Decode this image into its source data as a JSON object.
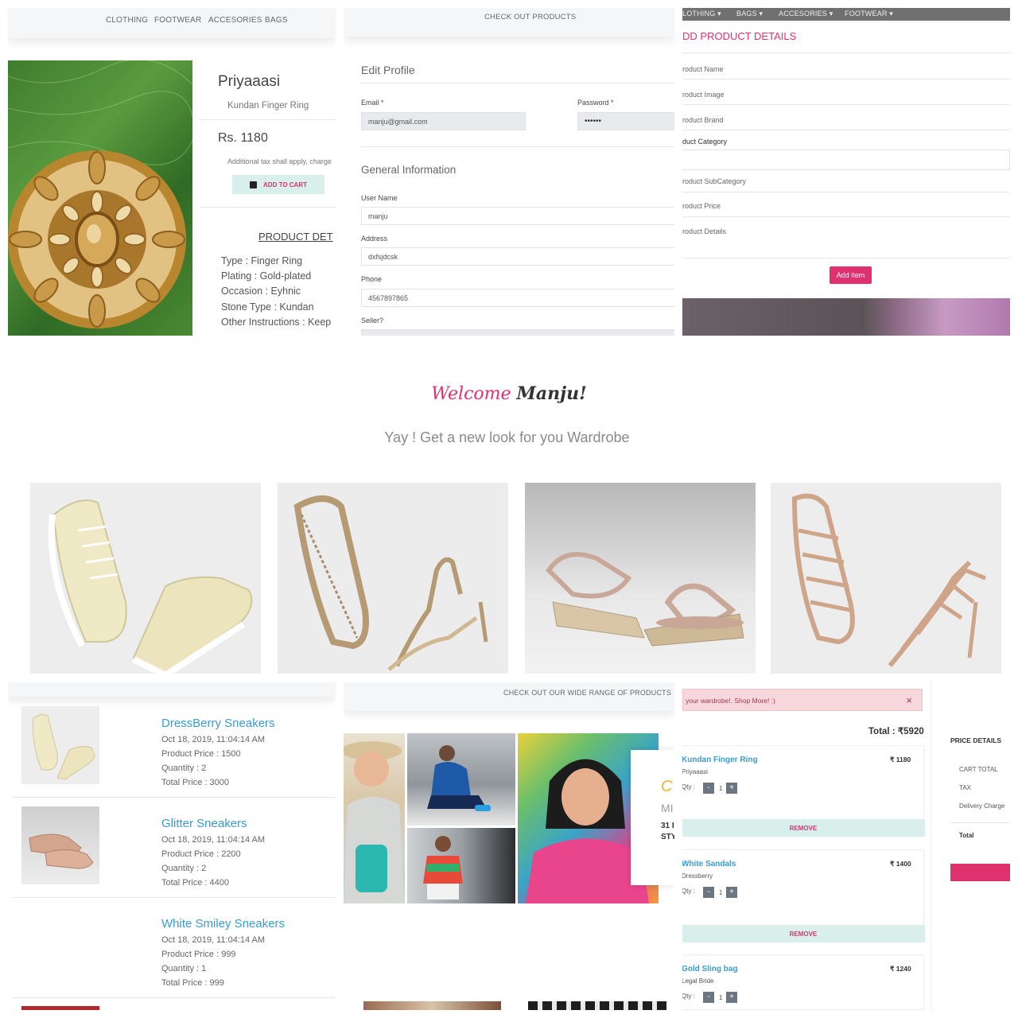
{
  "panel1": {
    "nav": [
      "CLOTHING",
      "FOOTWEAR",
      "ACCESORIES",
      "BAGS"
    ],
    "brand": "Priyaaasi",
    "product_name": "Kundan Finger Ring",
    "price": "Rs. 1180",
    "tax_note": "Additional tax shall apply, charge",
    "add_to_cart": "ADD TO CART",
    "details_heading": "PRODUCT DET",
    "details": [
      "Type : Finger Ring",
      "Plating : Gold-plated",
      "Occasion : Eyhnic",
      "Stone Type : Kundan",
      "Other Instructions : Keep"
    ]
  },
  "panel2": {
    "header": "CHECK OUT PRODUCTS",
    "edit_profile": "Edit Profile",
    "email_label": "Email *",
    "email_value": "manju@gmail.com",
    "password_label": "Password *",
    "password_value": "••••••",
    "general_info": "General Information",
    "username_label": "User Name",
    "username_value": "manju",
    "address_label": "Address",
    "address_value": "dxfsjdcsk",
    "phone_label": "Phone",
    "phone_value": "4567897865",
    "seller_label": "Seller?"
  },
  "panel3": {
    "nav": [
      "LOTHING ▾",
      "BAGS ▾",
      "ACCESORIES ▾",
      "FOOTWEAR ▾"
    ],
    "title": "DD PRODUCT DETAILS",
    "fields": [
      "roduct Name",
      "roduct Image",
      "roduct Brand",
      "duct Category",
      "roduct SubCategory",
      "roduct Price",
      "roduct Details"
    ],
    "add_item": "Add item"
  },
  "welcome": {
    "greeting": "Welcome",
    "name": "Manju!",
    "tagline": "Yay ! Get a new look for you Wardrobe"
  },
  "shoes": [
    {
      "icon": "sneaker-image"
    },
    {
      "icon": "heeled-sandal-image"
    },
    {
      "icon": "wedge-sandal-image"
    },
    {
      "icon": "gladiator-heel-image"
    }
  ],
  "orders": [
    {
      "name": "DressBerry Sneakers",
      "date": "Oct 18, 2019, 11:04:14 AM",
      "price": "Product Price : 1500",
      "qty": "Quantity : 2",
      "total": "Total Price : 3000"
    },
    {
      "name": "Glitter Sneakers",
      "date": "Oct 18, 2019, 11:04:14 AM",
      "price": "Product Price : 2200",
      "qty": "Quantity : 2",
      "total": "Total Price : 4400"
    },
    {
      "name": "White Smiley Sneakers",
      "date": "Oct 18, 2019, 11:04:14 AM",
      "price": "Product Price : 999",
      "qty": "Quantity : 1",
      "total": "Total Price : 999"
    }
  ],
  "promo": {
    "header": "CHECK OUT OUR WIDE RANGE OF PRODUCTS",
    "side_letters": "C",
    "side_text1": "MI",
    "side_text2": "31 I",
    "side_text3": "STY"
  },
  "cart": {
    "alert": "your wardrobe!. Shop More! :)",
    "alert_close": "×",
    "total": "Total : ₹5920",
    "items": [
      {
        "name": "Kundan Finger Ring",
        "brand": "Priyaaasi",
        "price": "₹ 1180",
        "qty_label": "Qty :",
        "qty": "1",
        "remove": "REMOVE"
      },
      {
        "name": "White Sandals",
        "brand": "Dressberry",
        "price": "₹ 1400",
        "qty_label": "Qty :",
        "qty": "1",
        "remove": "REMOVE"
      },
      {
        "name": "Gold Sling bag",
        "brand": "Legal Bride",
        "price": "₹ 1240",
        "qty_label": "Qty :",
        "qty": "1"
      }
    ],
    "price_details": "PRICE DETAILS",
    "rows": [
      "CART TOTAL",
      "TAX",
      "Delivery Charge",
      "Total"
    ]
  },
  "colors": {
    "accent_pink": "#e0316f",
    "link_blue": "#3a9bd0",
    "teal_btn": "#d8efec"
  }
}
